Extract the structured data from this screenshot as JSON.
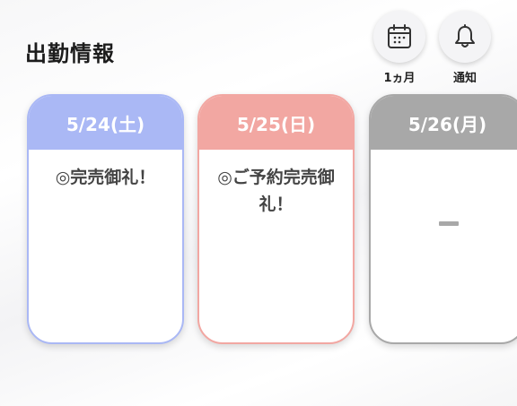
{
  "header": {
    "title": "出勤情報",
    "calendar_label": "1ヵ月",
    "notify_label": "通知"
  },
  "icons": {
    "calendar": "calendar-icon",
    "notify": "bell-icon"
  },
  "colors": {
    "saturday": "#aab8f5",
    "sunday": "#f2a7a2",
    "weekday": "#a8a8a8"
  },
  "schedule": [
    {
      "date": "5/24(土)",
      "status": "◎完売御礼！"
    },
    {
      "date": "5/25(日)",
      "status": "◎ご予約完売御礼！"
    },
    {
      "date": "5/26(月)",
      "status": "ー"
    }
  ]
}
